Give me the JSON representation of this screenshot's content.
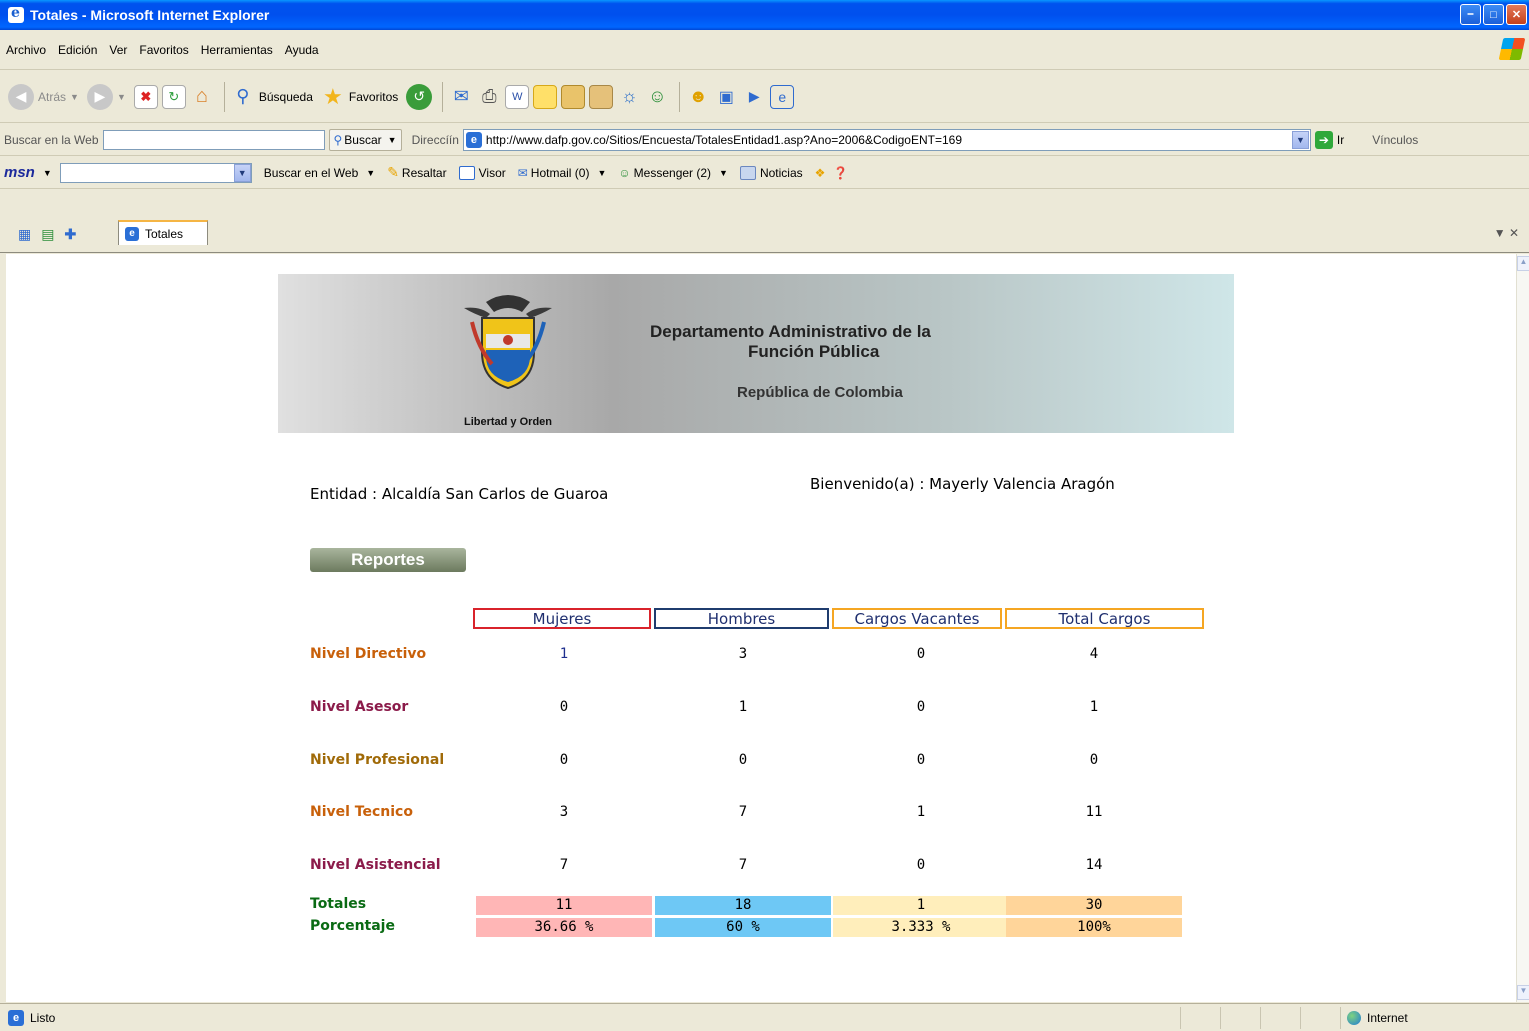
{
  "window": {
    "title": "Totales - Microsoft Internet Explorer"
  },
  "menu": [
    "Archivo",
    "Edición",
    "Ver",
    "Favoritos",
    "Herramientas",
    "Ayuda"
  ],
  "toolbar": {
    "back": "Atrás",
    "search": "Búsqueda",
    "favorites": "Favoritos"
  },
  "addressbar": {
    "search_label": "Buscar en la Web",
    "search_button": "Buscar",
    "address_label": "Direccíín",
    "url": "http://www.dafp.gov.co/Sitios/Encuesta/TotalesEntidad1.asp?Ano=2006&CodigoENT=169",
    "go_label": "Ir",
    "links_label": "Vínculos"
  },
  "msnbar": {
    "logo": "msn",
    "search_web": "Buscar en el Web",
    "highlight": "Resaltar",
    "viewer": "Visor",
    "hotmail": "Hotmail (0)",
    "messenger": "Messenger (2)",
    "news": "Noticias"
  },
  "tab": {
    "label": "Totales"
  },
  "banner": {
    "dept_line1": "Departamento Administrativo  de la",
    "dept_line2": "Función Pública",
    "republic": "República de Colombia",
    "motto": "Libertad y Orden"
  },
  "entity": "Entidad : Alcaldía San Carlos de Guaroa",
  "welcome": "Bienvenido(a) : Mayerly Valencia Aragón",
  "reports_button": "Reportes",
  "table": {
    "headers": [
      "Mujeres",
      "Hombres",
      "Cargos Vacantes",
      "Total Cargos"
    ],
    "header_colors": [
      "#d9232b",
      "#1f3c6e",
      "#f5a623",
      "#f5a623"
    ],
    "rows": [
      {
        "label": "Nivel Directivo",
        "color": "#c8600a",
        "values": [
          "1",
          "3",
          "0",
          "4"
        ]
      },
      {
        "label": "Nivel Asesor",
        "color": "#8b1b4a",
        "values": [
          "0",
          "1",
          "0",
          "1"
        ]
      },
      {
        "label": "Nivel Profesional",
        "color": "#a06a08",
        "values": [
          "0",
          "0",
          "0",
          "0"
        ]
      },
      {
        "label": "Nivel Tecnico",
        "color": "#c8600a",
        "values": [
          "3",
          "7",
          "1",
          "11"
        ]
      },
      {
        "label": "Nivel Asistencial",
        "color": "#8b1b4a",
        "values": [
          "7",
          "7",
          "0",
          "14"
        ]
      }
    ],
    "totals": {
      "label": "Totales",
      "values": [
        "11",
        "18",
        "1",
        "30"
      ]
    },
    "percent": {
      "label": "Porcentaje",
      "values": [
        "36.66 %",
        "60 %",
        "3.333 %",
        "100%"
      ]
    },
    "total_colors": [
      "#ffb6b6",
      "#6ec8f5",
      "#ffeebb",
      "#ffd59a"
    ],
    "summary_label_color": "#0a6b14"
  },
  "status": {
    "text": "Listo",
    "zone": "Internet"
  }
}
